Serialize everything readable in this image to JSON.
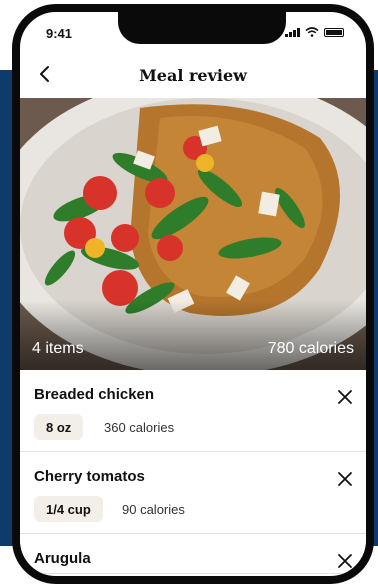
{
  "status_bar": {
    "time": "9:41"
  },
  "header": {
    "title": "Meal review"
  },
  "hero": {
    "item_count": "4 items",
    "total_calories": "780 calories"
  },
  "items": [
    {
      "name": "Breaded chicken",
      "portion": "8 oz",
      "calories": "360 calories"
    },
    {
      "name": "Cherry tomatos",
      "portion": "1/4 cup",
      "calories": "90 calories"
    },
    {
      "name": "Arugula"
    }
  ],
  "colors": {
    "background_accent": "#0c3b6c",
    "portion_chip": "#f3efe8"
  }
}
